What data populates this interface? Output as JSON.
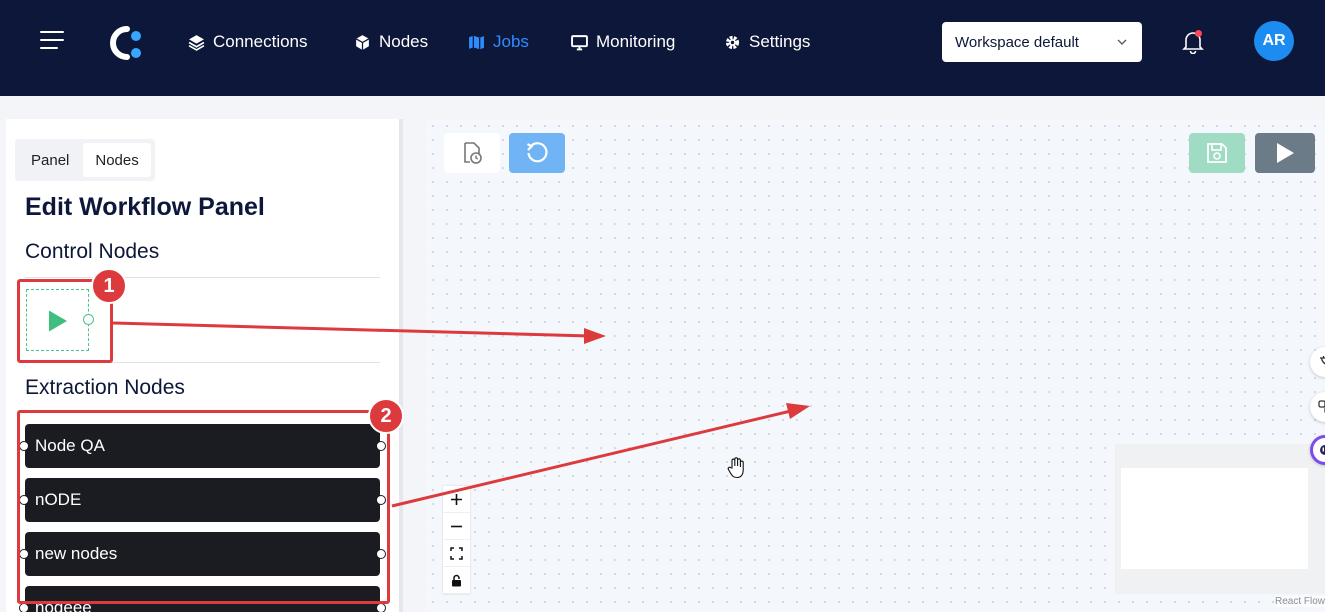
{
  "nav": {
    "items": [
      {
        "label": "Connections",
        "icon": "layers-icon",
        "active": false
      },
      {
        "label": "Nodes",
        "icon": "cube-icon",
        "active": false
      },
      {
        "label": "Jobs",
        "icon": "map-icon",
        "active": true
      },
      {
        "label": "Monitoring",
        "icon": "monitor-icon",
        "active": false
      },
      {
        "label": "Settings",
        "icon": "gear-icon",
        "active": false
      }
    ],
    "workspace": "Workspace default",
    "avatar_initials": "AR",
    "active_color": "#2f8cff",
    "bar_color": "#0c1739"
  },
  "panel": {
    "tabs": [
      {
        "label": "Panel",
        "active": false
      },
      {
        "label": "Nodes",
        "active": true
      }
    ],
    "title": "Edit Workflow Panel",
    "control_section": "Control Nodes",
    "extraction_section": "Extraction Nodes",
    "extraction_nodes": [
      "Node QA",
      "nODE",
      "new nodes",
      "nodeee"
    ]
  },
  "canvas": {
    "attribution": "React Flow"
  },
  "annotations": {
    "badge_1": "1",
    "badge_2": "2",
    "color": "#dd3a3e"
  }
}
